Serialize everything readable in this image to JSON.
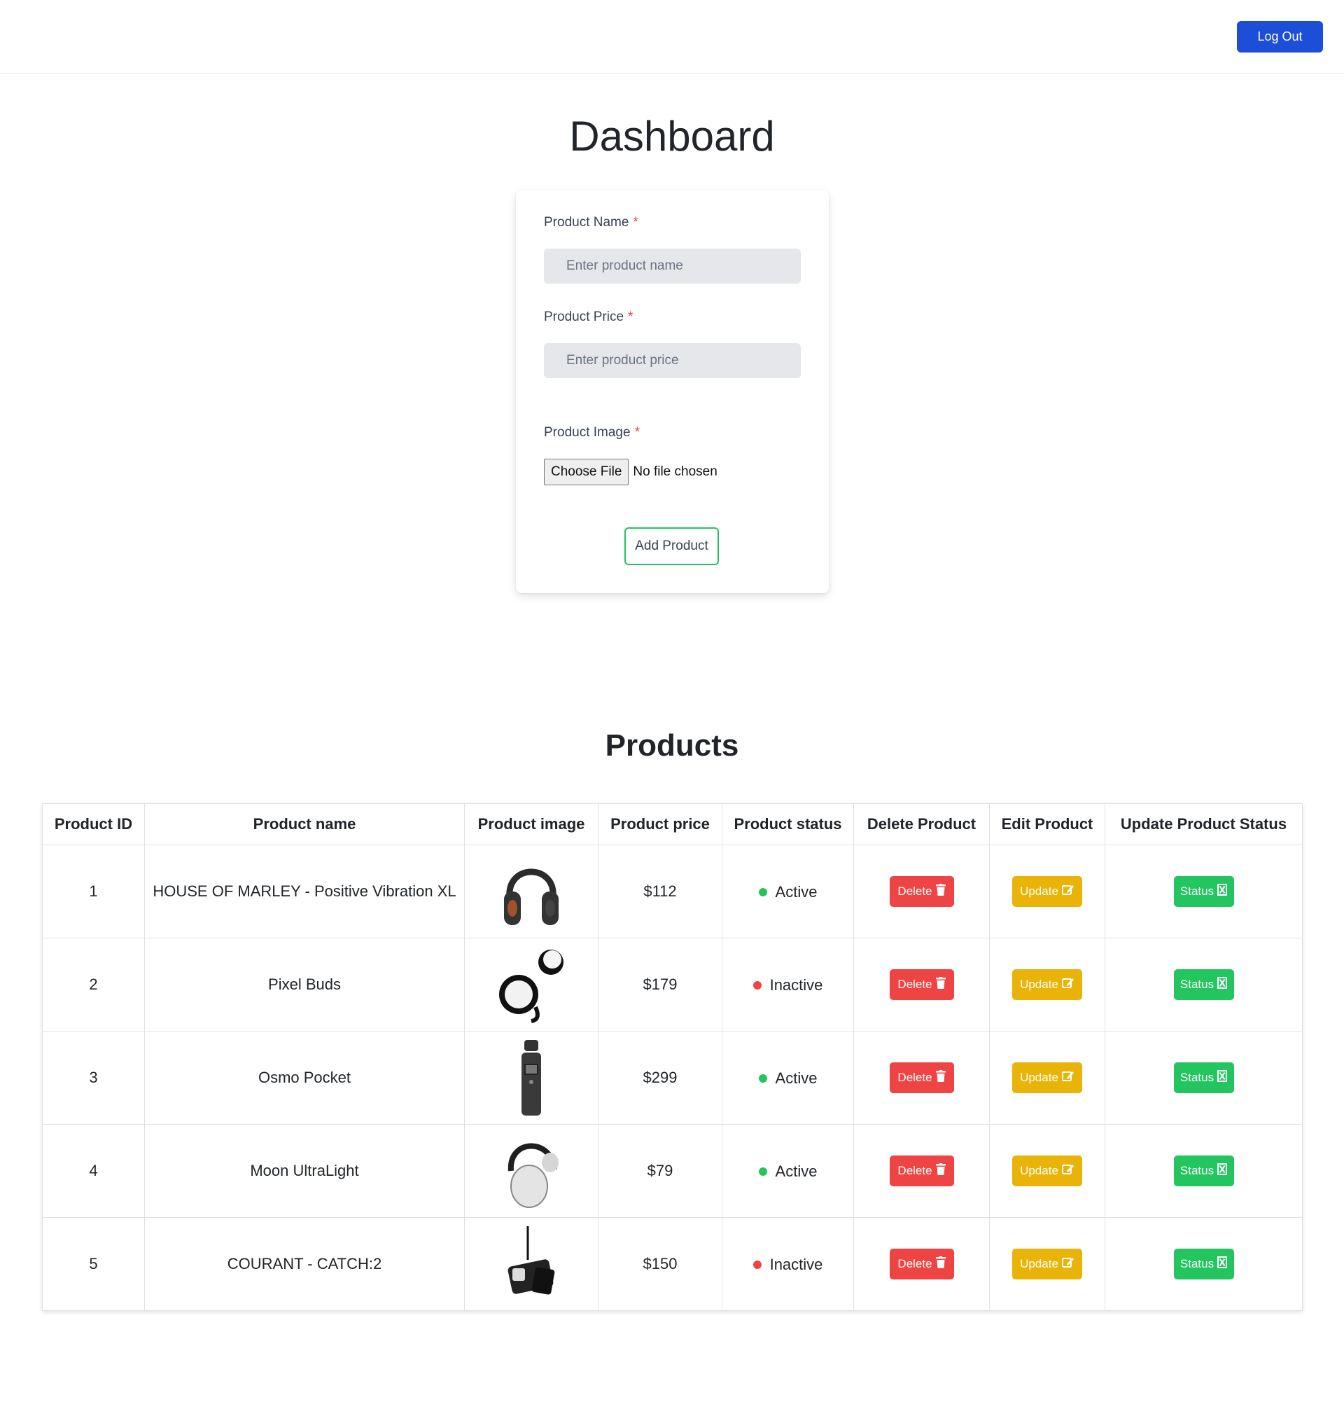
{
  "header": {
    "logout_label": "Log Out"
  },
  "page": {
    "title": "Dashboard"
  },
  "form": {
    "name_label": "Product Name",
    "name_placeholder": "Enter product name",
    "price_label": "Product Price",
    "price_placeholder": "Enter product price",
    "image_label": "Product Image",
    "required_mark": "*",
    "choose_file_label": "Choose File",
    "file_status": "No file chosen",
    "submit_label": "Add Product"
  },
  "products": {
    "title": "Products",
    "columns": [
      "Product ID",
      "Product name",
      "Product image",
      "Product price",
      "Product status",
      "Delete Product",
      "Edit Product",
      "Update Product Status"
    ],
    "rows": [
      {
        "id": "1",
        "name": "HOUSE OF MARLEY - Positive Vibration XL",
        "image_icon": "headphones-icon",
        "price": "$112",
        "status": "Active"
      },
      {
        "id": "2",
        "name": "Pixel Buds",
        "image_icon": "earbuds-icon",
        "price": "$179",
        "status": "Inactive"
      },
      {
        "id": "3",
        "name": "Osmo Pocket",
        "image_icon": "gimbal-camera-icon",
        "price": "$299",
        "status": "Active"
      },
      {
        "id": "4",
        "name": "Moon UltraLight",
        "image_icon": "headphones-white-icon",
        "price": "$79",
        "status": "Active"
      },
      {
        "id": "5",
        "name": "COURANT - CATCH:2",
        "image_icon": "charger-icon",
        "price": "$150",
        "status": "Inactive"
      }
    ],
    "delete_label": "Delete",
    "update_label": "Update",
    "status_label": "Status"
  },
  "colors": {
    "primary": "#1d4ed8",
    "delete": "#ef4444",
    "update": "#eab308",
    "status": "#22c55e",
    "active_dot": "#22c55e",
    "inactive_dot": "#ef4444"
  }
}
